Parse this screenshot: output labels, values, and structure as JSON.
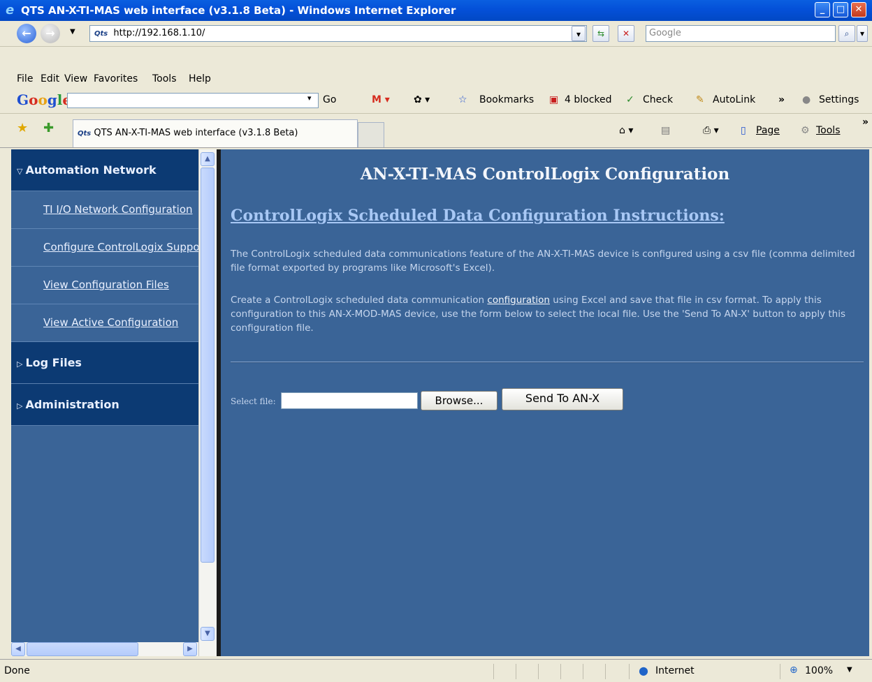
{
  "window": {
    "title": "QTS AN-X-TI-MAS web interface (v3.1.8 Beta) - Windows Internet Explorer"
  },
  "addressbar": {
    "favicon_text": "Qts",
    "url": "http://192.168.1.10/",
    "search_placeholder": "Google"
  },
  "menubar": {
    "items": [
      "File",
      "Edit",
      "View",
      "Favorites",
      "Tools",
      "Help"
    ]
  },
  "google_toolbar": {
    "logo": "Google",
    "go_label": "Go",
    "bookmarks_label": "Bookmarks",
    "blocked_label": "4 blocked",
    "check_label": "Check",
    "autolink_label": "AutoLink",
    "settings_label": "Settings"
  },
  "tabbar": {
    "tab_title": "QTS AN-X-TI-MAS web interface (v3.1.8 Beta)",
    "page_label": "Page",
    "tools_label": "Tools"
  },
  "sidebar": {
    "sections": [
      {
        "label": "Automation Network",
        "expanded": true,
        "items": [
          "TI I/O Network Configuration",
          "Configure ControlLogix Support",
          "View Configuration Files",
          "View Active Configuration"
        ]
      },
      {
        "label": "Log Files",
        "expanded": false
      },
      {
        "label": "Administration",
        "expanded": false
      }
    ]
  },
  "main": {
    "heading": "AN-X-TI-MAS ControlLogix Configuration",
    "subheading": "ControlLogix Scheduled Data Configuration Instructions:",
    "para1": "The ControlLogix scheduled data communications feature of the AN-X-TI-MAS device is configured using a csv file (comma delimited file format exported by programs like Microsoft's Excel).",
    "para2_before": "Create a ControlLogix scheduled data communication ",
    "para2_link": "configuration",
    "para2_after": " using Excel and save that file in csv format. To apply this configuration to this AN-X-MOD-MAS device, use the form below to select the local file. Use the 'Send To AN-X' button to apply this configuration file.",
    "select_label": "Select file:",
    "browse_label": "Browse...",
    "send_label": "Send To AN-X"
  },
  "statusbar": {
    "status": "Done",
    "zone": "Internet",
    "zoom": "100%"
  },
  "colors": {
    "sidebar_bg": "#3a6497",
    "sidebar_head_bg": "#0c3a73",
    "main_bg": "#3a6497",
    "titlebar": "#0450d8"
  }
}
